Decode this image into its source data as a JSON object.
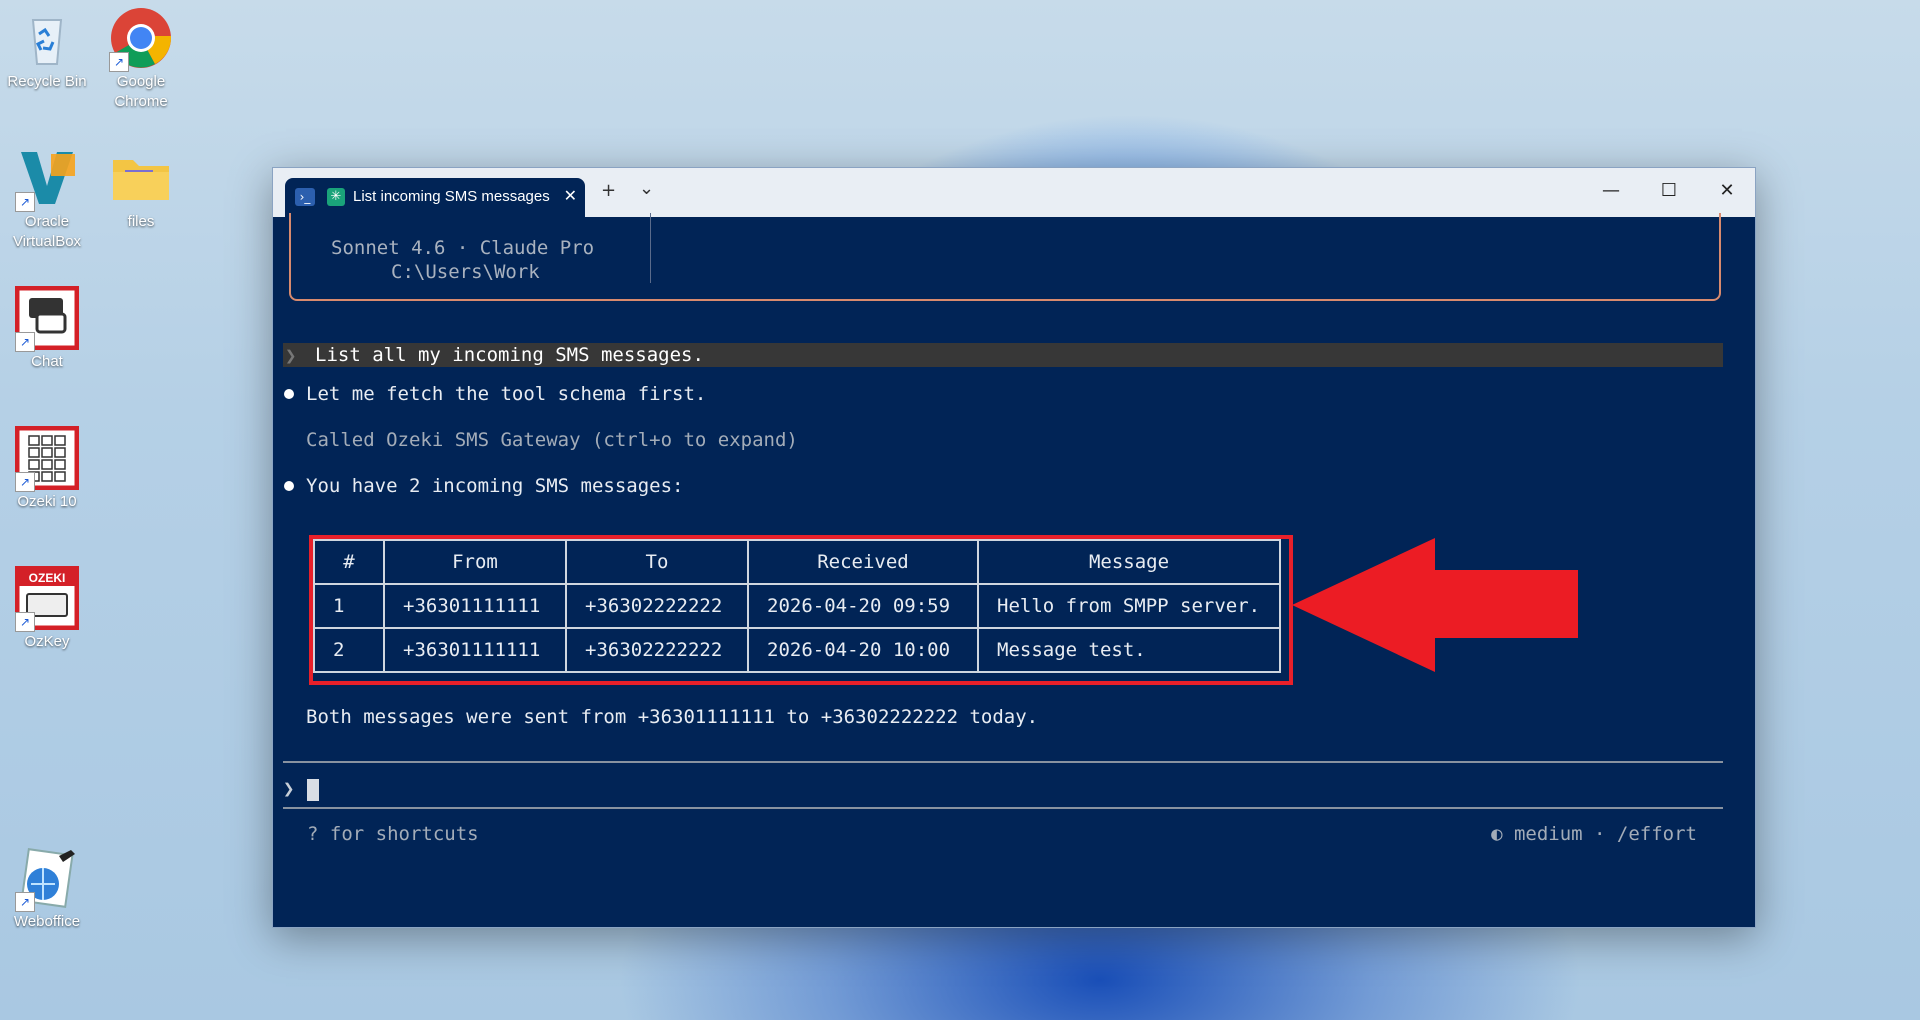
{
  "desktop": {
    "icons": [
      {
        "label": "Recycle Bin",
        "icon": "recycle-bin-icon"
      },
      {
        "label": "Google Chrome",
        "icon": "chrome-icon"
      },
      {
        "label": "Oracle VirtualBox",
        "icon": "virtualbox-icon"
      },
      {
        "label": "files",
        "icon": "folder-icon"
      },
      {
        "label": "Chat",
        "icon": "chat-icon"
      },
      {
        "label": "Ozeki 10",
        "icon": "ozeki-icon"
      },
      {
        "label": "OzKey",
        "icon": "ozkey-icon"
      },
      {
        "label": "Weboffice",
        "icon": "weboffice-icon"
      }
    ],
    "ozkey_badge": "OZEKI"
  },
  "window": {
    "tab_title": "List incoming SMS messages",
    "new_tab": "+",
    "dropdown": "⌄",
    "controls": {
      "minimize": "—",
      "maximize": "☐",
      "close": "✕"
    }
  },
  "terminal": {
    "welcome": {
      "model_line": "Sonnet 4.6 · Claude Pro",
      "path_line": "C:\\Users\\Work"
    },
    "user_prompt": "List all my incoming SMS messages.",
    "assistant_1": "Let me fetch the tool schema first.",
    "tool_call": "Called Ozeki SMS Gateway (ctrl+o to expand)",
    "assistant_2": "You have 2 incoming SMS messages:",
    "table": {
      "headers": [
        "#",
        "From",
        "To",
        "Received",
        "Message"
      ],
      "rows": [
        [
          "1",
          "+36301111111",
          "+36302222222",
          "2026-04-20 09:59",
          "Hello from SMPP server."
        ],
        [
          "2",
          "+36301111111",
          "+36302222222",
          "2026-04-20 10:00",
          "Message test."
        ]
      ]
    },
    "summary": "Both messages were sent from +36301111111 to +36302222222 today.",
    "prompt_symbol": "❯",
    "footer_left": "? for shortcuts",
    "footer_right": "◐ medium · /effort"
  },
  "colors": {
    "terminal_bg": "#012456",
    "highlight": "#e8202a",
    "welcome_border": "#d88a6e"
  }
}
